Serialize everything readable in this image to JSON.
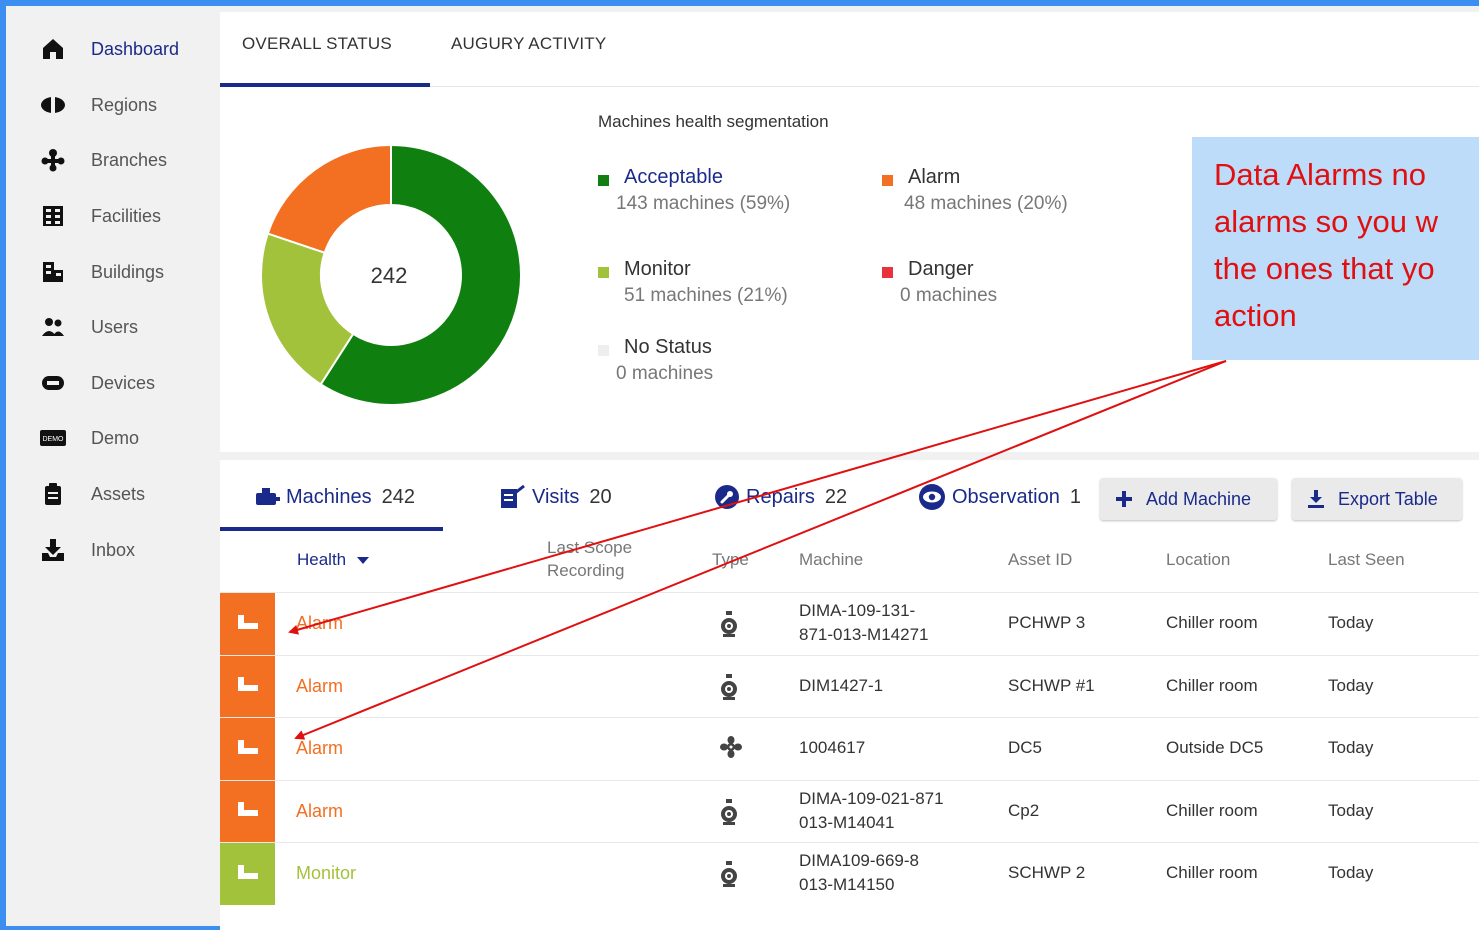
{
  "sidebar": {
    "items": [
      {
        "label": "Dashboard",
        "icon": "home-icon"
      },
      {
        "label": "Regions",
        "icon": "regions-icon"
      },
      {
        "label": "Branches",
        "icon": "branches-icon"
      },
      {
        "label": "Facilities",
        "icon": "facilities-icon"
      },
      {
        "label": "Buildings",
        "icon": "buildings-icon"
      },
      {
        "label": "Users",
        "icon": "users-icon"
      },
      {
        "label": "Devices",
        "icon": "devices-icon"
      },
      {
        "label": "Demo",
        "icon": "demo-icon"
      },
      {
        "label": "Assets",
        "icon": "assets-icon"
      },
      {
        "label": "Inbox",
        "icon": "inbox-icon"
      }
    ],
    "active": "Dashboard",
    "demo_badge": "DEMO"
  },
  "top_tabs": [
    "OVERALL STATUS",
    "AUGURY ACTIVITY"
  ],
  "health": {
    "title": "Machines health segmentation",
    "total": "242",
    "segments": [
      {
        "name": "Acceptable",
        "count_text": "143 machines (59%)",
        "value": 143,
        "color": "#0f7f0f"
      },
      {
        "name": "Alarm",
        "count_text": "48 machines (20%)",
        "value": 48,
        "color": "#f36f21"
      },
      {
        "name": "Monitor",
        "count_text": "51 machines (21%)",
        "value": 51,
        "color": "#a3c23b"
      },
      {
        "name": "Danger",
        "count_text": "0 machines",
        "value": 0,
        "color": "#e8323c"
      },
      {
        "name": "No Status",
        "count_text": "0 machines",
        "value": 0,
        "color": "#eeeeee"
      }
    ]
  },
  "list_tabs": {
    "machines": {
      "label": "Machines",
      "count": "242"
    },
    "visits": {
      "label": "Visits",
      "count": "20"
    },
    "repairs": {
      "label": "Repairs",
      "count": "22"
    },
    "observation": {
      "label": "Observation",
      "count": "1"
    }
  },
  "buttons": {
    "add_machine": "Add Machine",
    "export_table": "Export Table"
  },
  "table": {
    "headers": [
      "Health",
      "Last Scope Recording",
      "Type",
      "Machine",
      "Asset ID",
      "Location",
      "Last Seen"
    ],
    "rows": [
      {
        "status": "Alarm",
        "color": "#f36f21",
        "type_icon": "pump-icon",
        "machine": [
          "DIMA-109-131-",
          "871-013-M14271"
        ],
        "asset": "PCHWP 3",
        "location": "Chiller room",
        "seen": "Today"
      },
      {
        "status": "Alarm",
        "color": "#f36f21",
        "type_icon": "pump-icon",
        "machine": [
          "DIM1427-1"
        ],
        "asset": "SCHWP #1",
        "location": "Chiller room",
        "seen": "Today"
      },
      {
        "status": "Alarm",
        "color": "#f36f21",
        "type_icon": "fan-icon",
        "machine": [
          "1004617"
        ],
        "asset": "DC5",
        "location": "Outside DC5",
        "seen": "Today"
      },
      {
        "status": "Alarm",
        "color": "#f36f21",
        "type_icon": "pump-icon",
        "machine": [
          "DIMA-109-021-871",
          "013-M14041"
        ],
        "asset": "Cp2",
        "location": "Chiller room",
        "seen": "Today"
      },
      {
        "status": "Monitor",
        "color": "#a3c23b",
        "type_icon": "pump-icon",
        "machine": [
          "DIMA109-669-8",
          "013-M14150"
        ],
        "asset": "SCHWP 2",
        "location": "Chiller room",
        "seen": "Today"
      }
    ]
  },
  "callout": {
    "lines": [
      "Data Alarms no",
      "alarms so you w",
      "the ones that yo",
      "action"
    ],
    "color": "#e01010",
    "background": "#bcdcfa"
  }
}
